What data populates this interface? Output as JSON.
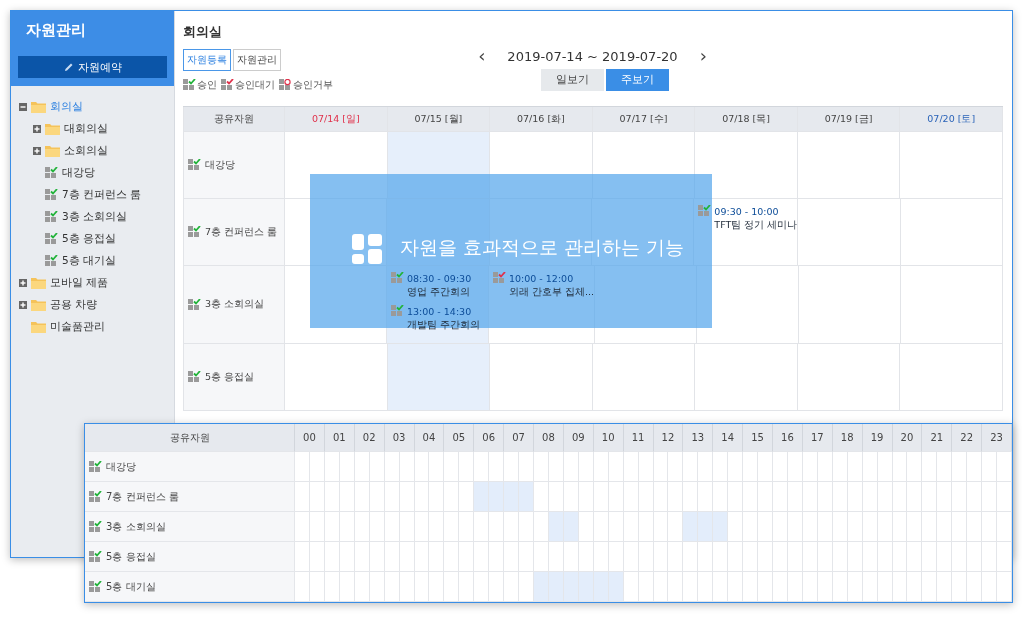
{
  "sidebar": {
    "title": "자원관리",
    "reserve_button": "자원예약",
    "tree": [
      {
        "label": "회의실",
        "kind": "folder",
        "expanded": true,
        "selected": true,
        "children": [
          {
            "label": "대회의실",
            "kind": "folder",
            "expanded": false,
            "selected": false
          },
          {
            "label": "소회의실",
            "kind": "folder",
            "expanded": false,
            "selected": false
          },
          {
            "label": "대강당",
            "kind": "resource",
            "selected": false
          },
          {
            "label": "7층 컨퍼런스 룸",
            "kind": "resource",
            "selected": false
          },
          {
            "label": "3층 소회의실",
            "kind": "resource",
            "selected": false
          },
          {
            "label": "5층 응접실",
            "kind": "resource",
            "selected": false
          },
          {
            "label": "5층 대기실",
            "kind": "resource",
            "selected": false
          }
        ]
      },
      {
        "label": "모바일 제품",
        "kind": "folder",
        "expanded": false,
        "selected": false
      },
      {
        "label": "공용 차량",
        "kind": "folder",
        "expanded": false,
        "selected": false
      },
      {
        "label": "미술품관리",
        "kind": "folder",
        "selected": false
      }
    ]
  },
  "main": {
    "title": "회의실",
    "actions": [
      {
        "label": "자원등록",
        "selected": true
      },
      {
        "label": "자원관리",
        "selected": false
      }
    ],
    "legend": [
      {
        "label": "승인",
        "kind": "approved"
      },
      {
        "label": "승인대기",
        "kind": "pending"
      },
      {
        "label": "승인거부",
        "kind": "rejected"
      }
    ],
    "prev": "‹",
    "range": "2019-07-14 ~ 2019-07-20",
    "next": "›",
    "views": [
      {
        "label": "일보기",
        "selected": false
      },
      {
        "label": "주보기",
        "selected": true
      }
    ],
    "week_table": {
      "corner": "공유자원",
      "days": [
        {
          "label": "07/14 [일]",
          "kind": "sunday",
          "selected": false
        },
        {
          "label": "07/15 [월]",
          "kind": "weekday",
          "selected": true
        },
        {
          "label": "07/16 [화]",
          "kind": "weekday",
          "selected": false
        },
        {
          "label": "07/17 [수]",
          "kind": "weekday",
          "selected": false
        },
        {
          "label": "07/18 [목]",
          "kind": "weekday",
          "selected": false
        },
        {
          "label": "07/19 [금]",
          "kind": "weekday",
          "selected": false
        },
        {
          "label": "07/20 [토]",
          "kind": "saturday",
          "selected": false
        }
      ],
      "rows": [
        {
          "name": "대강당",
          "cells": [
            {},
            {},
            {},
            {},
            {},
            {},
            {}
          ]
        },
        {
          "name": "7층 컨퍼런스 룸",
          "cells": [
            {},
            {},
            {},
            {},
            {
              "events": [
                {
                  "time": "09:30 - 10:00",
                  "title": "TFT팀 정기 세미나",
                  "kind": "approved"
                }
              ]
            },
            {},
            {}
          ]
        },
        {
          "name": "3층 소회의실",
          "cells": [
            {},
            {
              "events": [
                {
                  "time": "08:30 - 09:30",
                  "title": "영업 주간회의",
                  "kind": "approved"
                },
                {
                  "time": "13:00 - 14:30",
                  "title": "개발팀 주간회의",
                  "kind": "approved"
                }
              ]
            },
            {
              "events": [
                {
                  "time": "10:00 - 12:00",
                  "title": "외래 간호부 집체...",
                  "kind": "pending"
                }
              ]
            },
            {},
            {},
            {},
            {}
          ]
        },
        {
          "name": "5층 응접실",
          "cells": [
            {},
            {},
            {},
            {},
            {},
            {},
            {}
          ]
        }
      ]
    }
  },
  "day_view": {
    "corner": "공유자원",
    "hours": [
      "00",
      "01",
      "02",
      "03",
      "04",
      "05",
      "06",
      "07",
      "08",
      "09",
      "10",
      "11",
      "12",
      "13",
      "14",
      "15",
      "16",
      "17",
      "18",
      "19",
      "20",
      "21",
      "22",
      "23"
    ],
    "rows": [
      {
        "name": "대강당",
        "slots": [
          false,
          false,
          false,
          false,
          false,
          false,
          false,
          false,
          false,
          false,
          false,
          false,
          false,
          false,
          false,
          false,
          false,
          false,
          false,
          false,
          false,
          false,
          false,
          false,
          false,
          false,
          false,
          false,
          false,
          false,
          false,
          false,
          false,
          false,
          false,
          false,
          false,
          false,
          false,
          false,
          false,
          false,
          false,
          false,
          false,
          false,
          false,
          false
        ]
      },
      {
        "name": "7층 컨퍼런스 룸",
        "slots": [
          false,
          false,
          false,
          false,
          false,
          false,
          false,
          false,
          false,
          false,
          false,
          false,
          true,
          true,
          true,
          true,
          false,
          false,
          false,
          false,
          false,
          false,
          false,
          false,
          false,
          false,
          false,
          false,
          false,
          false,
          false,
          false,
          false,
          false,
          false,
          false,
          false,
          false,
          false,
          false,
          false,
          false,
          false,
          false,
          false,
          false,
          false,
          false
        ]
      },
      {
        "name": "3층 소회의실",
        "slots": [
          false,
          false,
          false,
          false,
          false,
          false,
          false,
          false,
          false,
          false,
          false,
          false,
          false,
          false,
          false,
          false,
          false,
          true,
          true,
          false,
          false,
          false,
          false,
          false,
          false,
          false,
          true,
          true,
          true,
          false,
          false,
          false,
          false,
          false,
          false,
          false,
          false,
          false,
          false,
          false,
          false,
          false,
          false,
          false,
          false,
          false,
          false,
          false
        ]
      },
      {
        "name": "5층 응접실",
        "slots": [
          false,
          false,
          false,
          false,
          false,
          false,
          false,
          false,
          false,
          false,
          false,
          false,
          false,
          false,
          false,
          false,
          false,
          false,
          false,
          false,
          false,
          false,
          false,
          false,
          false,
          false,
          false,
          false,
          false,
          false,
          false,
          false,
          false,
          false,
          false,
          false,
          false,
          false,
          false,
          false,
          false,
          false,
          false,
          false,
          false,
          false,
          false,
          false
        ]
      },
      {
        "name": "5층 대기실",
        "slots": [
          false,
          false,
          false,
          false,
          false,
          false,
          false,
          false,
          false,
          false,
          false,
          false,
          false,
          false,
          false,
          false,
          true,
          true,
          true,
          true,
          true,
          true,
          false,
          false,
          false,
          false,
          false,
          false,
          false,
          false,
          false,
          false,
          false,
          false,
          false,
          false,
          false,
          false,
          false,
          false,
          false,
          false,
          false,
          false,
          false,
          false,
          false,
          false
        ]
      }
    ]
  },
  "banner": {
    "text": "자원을 효과적으로 관리하는 기능"
  }
}
